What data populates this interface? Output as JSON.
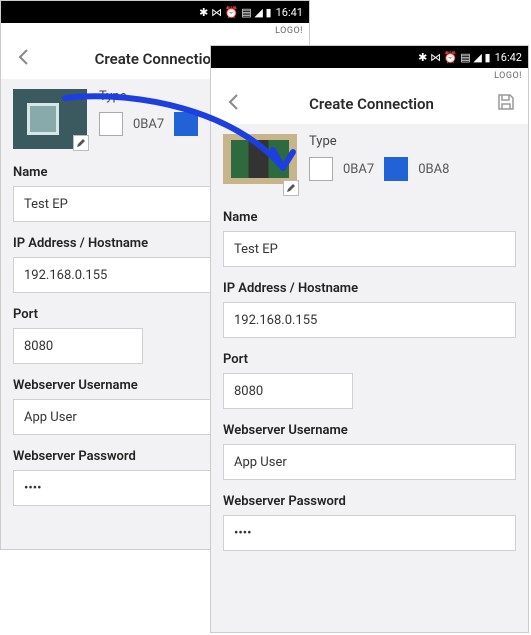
{
  "screenA": {
    "status": {
      "icons": "✱ ⋈ ⏰ ▤ ◢ ▮",
      "time": "16:41"
    },
    "brand": "LOGO!",
    "header": {
      "title": "Create Connection"
    },
    "type": {
      "label": "Type",
      "opt1": "0BA7"
    },
    "fields": {
      "name_label": "Name",
      "name_value": "Test EP",
      "ip_label": "IP Address / Hostname",
      "ip_value": "192.168.0.155",
      "port_label": "Port",
      "port_value": "8080",
      "user_label": "Webserver Username",
      "user_value": "App User",
      "pass_label": "Webserver Password",
      "pass_value": "••••"
    }
  },
  "screenB": {
    "status": {
      "icons": "✱ ⋈ ⏰ ▤ ◢ ▮",
      "time": "16:42"
    },
    "brand": "LOGO!",
    "header": {
      "title": "Create Connection"
    },
    "type": {
      "label": "Type",
      "opt1": "0BA7",
      "opt2": "0BA8"
    },
    "fields": {
      "name_label": "Name",
      "name_value": "Test EP",
      "ip_label": "IP Address / Hostname",
      "ip_value": "192.168.0.155",
      "port_label": "Port",
      "port_value": "8080",
      "user_label": "Webserver Username",
      "user_value": "App User",
      "pass_label": "Webserver Password",
      "pass_value": "••••"
    }
  }
}
